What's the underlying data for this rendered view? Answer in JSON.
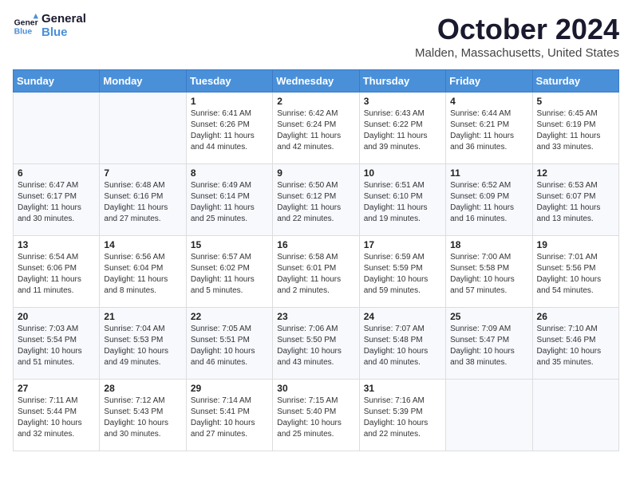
{
  "logo": {
    "line1": "General",
    "line2": "Blue"
  },
  "title": "October 2024",
  "location": "Malden, Massachusetts, United States",
  "days_of_week": [
    "Sunday",
    "Monday",
    "Tuesday",
    "Wednesday",
    "Thursday",
    "Friday",
    "Saturday"
  ],
  "weeks": [
    [
      {
        "day": "",
        "info": ""
      },
      {
        "day": "",
        "info": ""
      },
      {
        "day": "1",
        "info": "Sunrise: 6:41 AM\nSunset: 6:26 PM\nDaylight: 11 hours and 44 minutes."
      },
      {
        "day": "2",
        "info": "Sunrise: 6:42 AM\nSunset: 6:24 PM\nDaylight: 11 hours and 42 minutes."
      },
      {
        "day": "3",
        "info": "Sunrise: 6:43 AM\nSunset: 6:22 PM\nDaylight: 11 hours and 39 minutes."
      },
      {
        "day": "4",
        "info": "Sunrise: 6:44 AM\nSunset: 6:21 PM\nDaylight: 11 hours and 36 minutes."
      },
      {
        "day": "5",
        "info": "Sunrise: 6:45 AM\nSunset: 6:19 PM\nDaylight: 11 hours and 33 minutes."
      }
    ],
    [
      {
        "day": "6",
        "info": "Sunrise: 6:47 AM\nSunset: 6:17 PM\nDaylight: 11 hours and 30 minutes."
      },
      {
        "day": "7",
        "info": "Sunrise: 6:48 AM\nSunset: 6:16 PM\nDaylight: 11 hours and 27 minutes."
      },
      {
        "day": "8",
        "info": "Sunrise: 6:49 AM\nSunset: 6:14 PM\nDaylight: 11 hours and 25 minutes."
      },
      {
        "day": "9",
        "info": "Sunrise: 6:50 AM\nSunset: 6:12 PM\nDaylight: 11 hours and 22 minutes."
      },
      {
        "day": "10",
        "info": "Sunrise: 6:51 AM\nSunset: 6:10 PM\nDaylight: 11 hours and 19 minutes."
      },
      {
        "day": "11",
        "info": "Sunrise: 6:52 AM\nSunset: 6:09 PM\nDaylight: 11 hours and 16 minutes."
      },
      {
        "day": "12",
        "info": "Sunrise: 6:53 AM\nSunset: 6:07 PM\nDaylight: 11 hours and 13 minutes."
      }
    ],
    [
      {
        "day": "13",
        "info": "Sunrise: 6:54 AM\nSunset: 6:06 PM\nDaylight: 11 hours and 11 minutes."
      },
      {
        "day": "14",
        "info": "Sunrise: 6:56 AM\nSunset: 6:04 PM\nDaylight: 11 hours and 8 minutes."
      },
      {
        "day": "15",
        "info": "Sunrise: 6:57 AM\nSunset: 6:02 PM\nDaylight: 11 hours and 5 minutes."
      },
      {
        "day": "16",
        "info": "Sunrise: 6:58 AM\nSunset: 6:01 PM\nDaylight: 11 hours and 2 minutes."
      },
      {
        "day": "17",
        "info": "Sunrise: 6:59 AM\nSunset: 5:59 PM\nDaylight: 10 hours and 59 minutes."
      },
      {
        "day": "18",
        "info": "Sunrise: 7:00 AM\nSunset: 5:58 PM\nDaylight: 10 hours and 57 minutes."
      },
      {
        "day": "19",
        "info": "Sunrise: 7:01 AM\nSunset: 5:56 PM\nDaylight: 10 hours and 54 minutes."
      }
    ],
    [
      {
        "day": "20",
        "info": "Sunrise: 7:03 AM\nSunset: 5:54 PM\nDaylight: 10 hours and 51 minutes."
      },
      {
        "day": "21",
        "info": "Sunrise: 7:04 AM\nSunset: 5:53 PM\nDaylight: 10 hours and 49 minutes."
      },
      {
        "day": "22",
        "info": "Sunrise: 7:05 AM\nSunset: 5:51 PM\nDaylight: 10 hours and 46 minutes."
      },
      {
        "day": "23",
        "info": "Sunrise: 7:06 AM\nSunset: 5:50 PM\nDaylight: 10 hours and 43 minutes."
      },
      {
        "day": "24",
        "info": "Sunrise: 7:07 AM\nSunset: 5:48 PM\nDaylight: 10 hours and 40 minutes."
      },
      {
        "day": "25",
        "info": "Sunrise: 7:09 AM\nSunset: 5:47 PM\nDaylight: 10 hours and 38 minutes."
      },
      {
        "day": "26",
        "info": "Sunrise: 7:10 AM\nSunset: 5:46 PM\nDaylight: 10 hours and 35 minutes."
      }
    ],
    [
      {
        "day": "27",
        "info": "Sunrise: 7:11 AM\nSunset: 5:44 PM\nDaylight: 10 hours and 32 minutes."
      },
      {
        "day": "28",
        "info": "Sunrise: 7:12 AM\nSunset: 5:43 PM\nDaylight: 10 hours and 30 minutes."
      },
      {
        "day": "29",
        "info": "Sunrise: 7:14 AM\nSunset: 5:41 PM\nDaylight: 10 hours and 27 minutes."
      },
      {
        "day": "30",
        "info": "Sunrise: 7:15 AM\nSunset: 5:40 PM\nDaylight: 10 hours and 25 minutes."
      },
      {
        "day": "31",
        "info": "Sunrise: 7:16 AM\nSunset: 5:39 PM\nDaylight: 10 hours and 22 minutes."
      },
      {
        "day": "",
        "info": ""
      },
      {
        "day": "",
        "info": ""
      }
    ]
  ]
}
